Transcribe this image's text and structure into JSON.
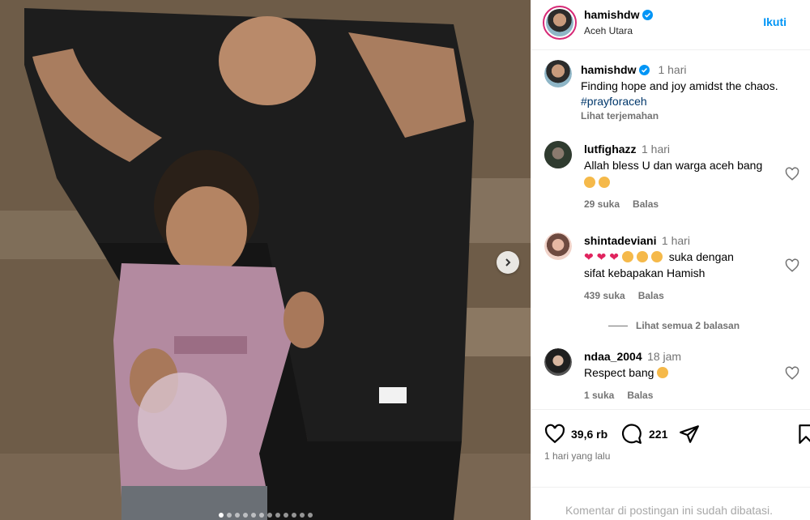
{
  "media": {
    "carousel_dot_count": 12,
    "active_dot": 0
  },
  "post": {
    "username": "hamishdw",
    "location": "Aceh Utara",
    "follow_label": "Ikuti"
  },
  "caption": {
    "username": "hamishdw",
    "time": "1 hari",
    "text": "Finding hope and joy amidst the chaos.",
    "hashtag": "#prayforaceh",
    "translate": "Lihat terjemahan"
  },
  "comments": [
    {
      "username": "lutfighazz",
      "time": "1 hari",
      "text": "Allah bless U dan warga aceh bang",
      "likes": "29 suka",
      "reply": "Balas"
    },
    {
      "username": "shintadeviani",
      "time": "1 hari",
      "text": "suka dengan",
      "text2": "sifat kebapakan Hamish",
      "likes": "439 suka",
      "reply": "Balas",
      "view_replies": "Lihat semua 2 balasan"
    },
    {
      "username": "ndaa_2004",
      "time": "18 jam",
      "text": "Respect bang",
      "likes": "1 suka",
      "reply": "Balas"
    }
  ],
  "stats": {
    "likes": "39,6 rb",
    "comments": "221",
    "posted": "1 hari yang lalu"
  },
  "footer": {
    "notice": "Komentar di postingan ini sudah dibatasi."
  },
  "colors": {
    "accent": "#0095f6",
    "hashtag": "#00376b",
    "muted": "#737373",
    "verified": "#0095f6",
    "story_ring": "#d62976"
  }
}
